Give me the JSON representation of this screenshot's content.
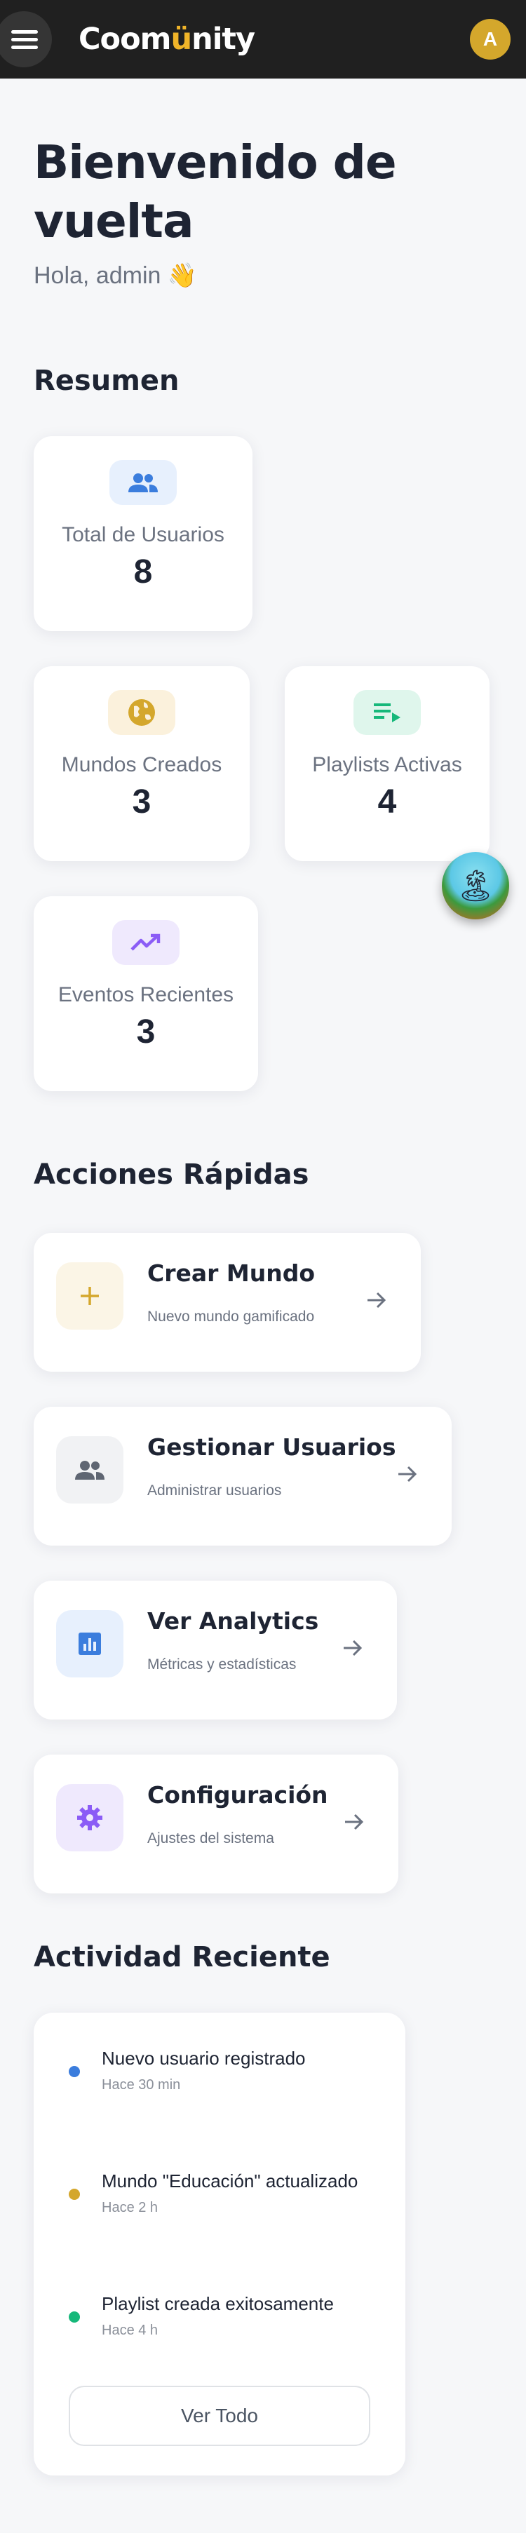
{
  "app": {
    "logo_text": "Coomünity",
    "user_initial": "A"
  },
  "colors": {
    "topbar": "#202020",
    "accent": "#f0b429",
    "avatar": "#d4a72c",
    "blue": "#3b7ddd",
    "gold": "#d4a72c",
    "green": "#16b87a",
    "purple": "#8b5cf6"
  },
  "header": {
    "title": "Bienvenido de vuelta",
    "greeting": "Hola, admin 👋"
  },
  "summary": {
    "title": "Resumen",
    "stats": [
      {
        "label": "Total de Usuarios",
        "value": "8",
        "icon": "users-icon"
      },
      {
        "label": "Mundos Creados",
        "value": "3",
        "icon": "globe-icon"
      },
      {
        "label": "Playlists Activas",
        "value": "4",
        "icon": "playlist-icon"
      },
      {
        "label": "Eventos Recientes",
        "value": "3",
        "icon": "trending-up-icon"
      }
    ]
  },
  "quick_actions": {
    "title": "Acciones Rápidas",
    "items": [
      {
        "title": "Crear Mundo",
        "subtitle": "Nuevo mundo gamificado",
        "icon": "plus-icon"
      },
      {
        "title": "Gestionar Usuarios",
        "subtitle": "Administrar usuarios",
        "icon": "users-icon"
      },
      {
        "title": "Ver Analytics",
        "subtitle": "Métricas y estadísticas",
        "icon": "analytics-icon"
      },
      {
        "title": "Configuración",
        "subtitle": "Ajustes del sistema",
        "icon": "gear-icon"
      }
    ]
  },
  "activity": {
    "title": "Actividad Reciente",
    "items": [
      {
        "title": "Nuevo usuario registrado",
        "time": "Hace 30 min",
        "color": "#3b7ddd"
      },
      {
        "title": "Mundo \"Educación\" actualizado",
        "time": "Hace 2 h",
        "color": "#d4a72c"
      },
      {
        "title": "Playlist creada exitosamente",
        "time": "Hace 4 h",
        "color": "#16b87a"
      }
    ],
    "see_all_label": "Ver Todo"
  }
}
